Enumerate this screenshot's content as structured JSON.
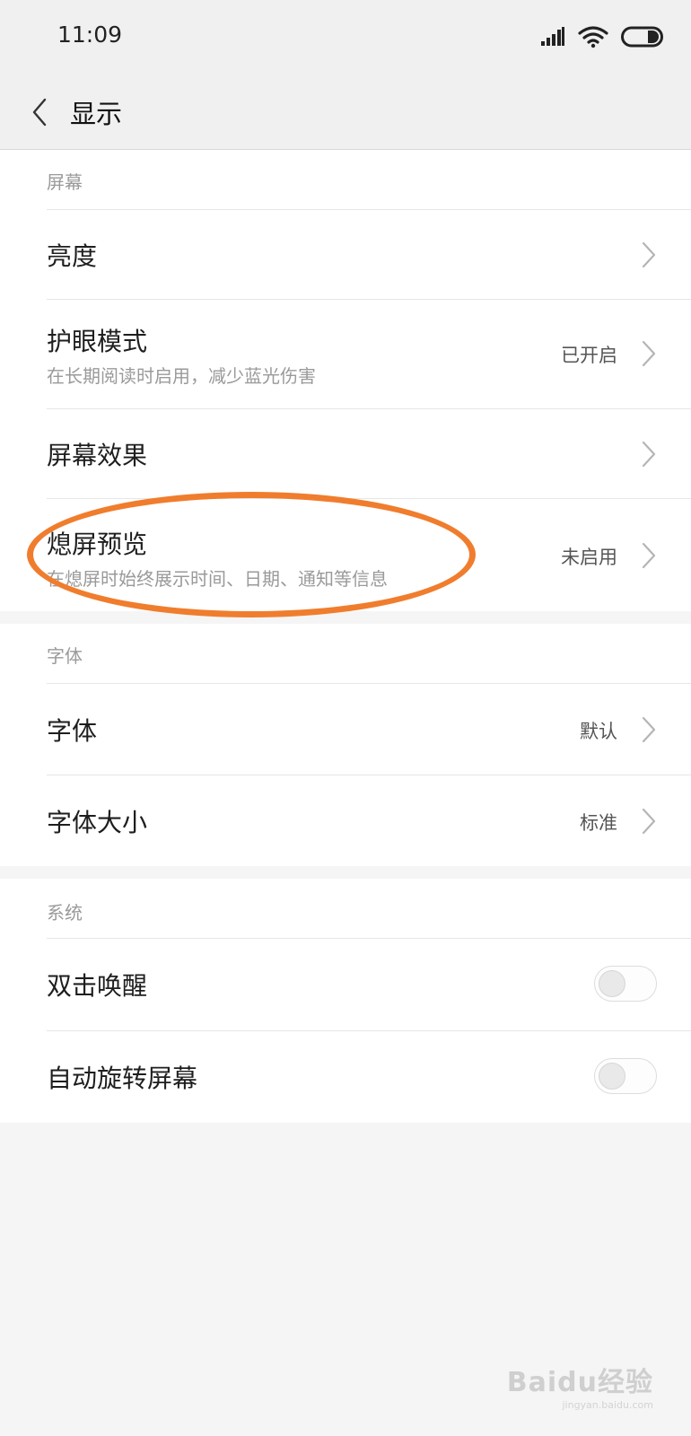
{
  "status_bar": {
    "time": "11:09",
    "icons": [
      "signal-icon",
      "wifi-icon",
      "battery-icon"
    ]
  },
  "header": {
    "back_icon": "chevron-left-icon",
    "title": "显示"
  },
  "sections": [
    {
      "header": "屏幕",
      "rows": [
        {
          "title": "亮度",
          "subtitle": "",
          "value": "",
          "control": "chevron"
        },
        {
          "title": "护眼模式",
          "subtitle": "在长期阅读时启用，减少蓝光伤害",
          "value": "已开启",
          "control": "chevron"
        },
        {
          "title": "屏幕效果",
          "subtitle": "",
          "value": "",
          "control": "chevron"
        },
        {
          "title": "熄屏预览",
          "subtitle": "在熄屏时始终展示时间、日期、通知等信息",
          "value": "未启用",
          "control": "chevron"
        }
      ]
    },
    {
      "header": "字体",
      "rows": [
        {
          "title": "字体",
          "subtitle": "",
          "value": "默认",
          "control": "chevron"
        },
        {
          "title": "字体大小",
          "subtitle": "",
          "value": "标准",
          "control": "chevron"
        }
      ]
    },
    {
      "header": "系统",
      "rows": [
        {
          "title": "双击唤醒",
          "subtitle": "",
          "value": "",
          "control": "toggle",
          "on": false
        },
        {
          "title": "自动旋转屏幕",
          "subtitle": "",
          "value": "",
          "control": "toggle",
          "on": false
        }
      ]
    }
  ],
  "annotation": {
    "color": "#f07d2d",
    "shape": "ellipse",
    "target": "熄屏预览"
  },
  "watermark": {
    "text": "Baidu经验",
    "subtext": "jingyan.baidu.com"
  }
}
